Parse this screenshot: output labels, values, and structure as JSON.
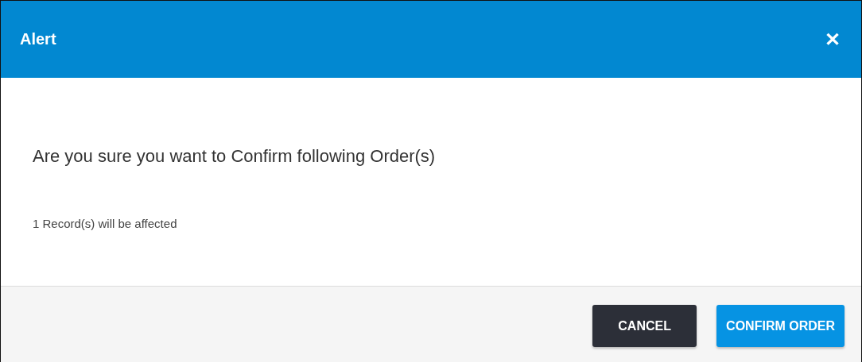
{
  "dialog": {
    "title": "Alert",
    "close": "✕"
  },
  "message": "Are you sure you want to Confirm following Order(s)",
  "note": "1 Record(s) will be affected",
  "buttons": [
    {
      "label": "CANCEL",
      "kind": "secondary"
    },
    {
      "label": "CONFIRM ORDER",
      "kind": "primary"
    }
  ]
}
